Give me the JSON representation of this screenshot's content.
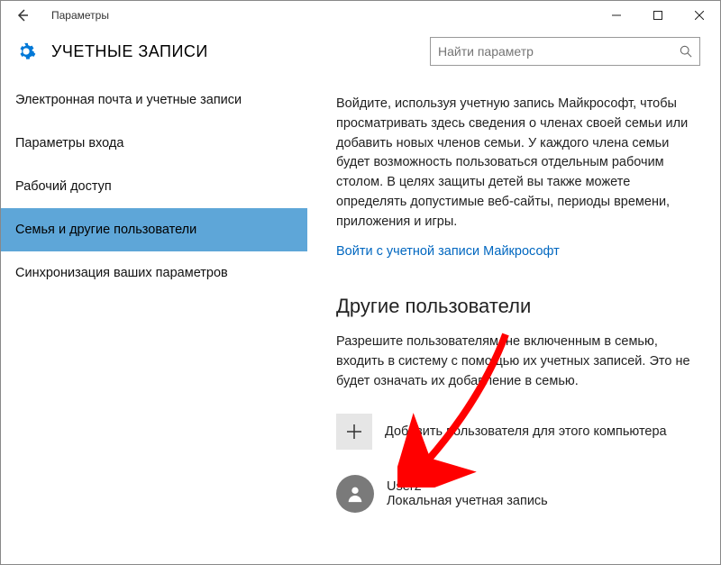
{
  "window": {
    "title": "Параметры"
  },
  "header": {
    "page_title": "УЧЕТНЫЕ ЗАПИСИ"
  },
  "search": {
    "placeholder": "Найти параметр"
  },
  "sidebar": {
    "items": [
      {
        "label": "Электронная почта и учетные записи"
      },
      {
        "label": "Параметры входа"
      },
      {
        "label": "Рабочий доступ"
      },
      {
        "label": "Семья и другие пользователи"
      },
      {
        "label": "Синхронизация ваших параметров"
      }
    ],
    "selected_index": 3
  },
  "main": {
    "intro_para": "Войдите, используя учетную запись Майкрософт, чтобы просматривать здесь сведения о членах своей семьи или добавить новых членов семьи. У каждого члена семьи будет возможность пользоваться отдельным рабочим столом. В целях защиты детей вы также можете определять допустимые веб-сайты, периоды времени, приложения и игры.",
    "signin_link": "Войти с учетной записи Майкрософт",
    "section_title": "Другие пользователи",
    "section_para": "Разрешите пользователям, не включенным в семью, входить в систему с помощью их учетных записей. Это не будет означать их добавление в семью.",
    "add_user_label": "Добавить пользователя для этого компьютера",
    "user": {
      "name": "User2",
      "type": "Локальная учетная запись"
    }
  }
}
